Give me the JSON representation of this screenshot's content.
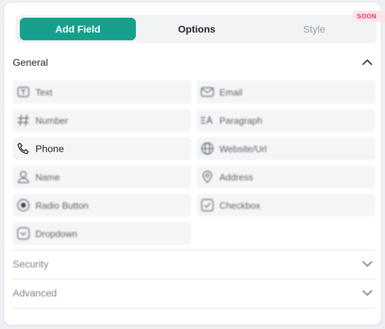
{
  "tabs": {
    "add_field": "Add Field",
    "options": "Options",
    "style": "Style",
    "soon_badge": "SOON"
  },
  "sections": {
    "general": "General",
    "security": "Security",
    "advanced": "Advanced"
  },
  "fields": [
    {
      "label": "Text",
      "icon": "text-box-icon"
    },
    {
      "label": "Email",
      "icon": "envelope-icon"
    },
    {
      "label": "Number",
      "icon": "hash-icon"
    },
    {
      "label": "Paragraph",
      "icon": "paragraph-icon"
    },
    {
      "label": "Phone",
      "icon": "phone-icon"
    },
    {
      "label": "Website/Url",
      "icon": "globe-icon"
    },
    {
      "label": "Name",
      "icon": "person-icon"
    },
    {
      "label": "Address",
      "icon": "map-pin-icon"
    },
    {
      "label": "Radio Button",
      "icon": "radio-icon"
    },
    {
      "label": "Checkbox",
      "icon": "checkbox-icon"
    },
    {
      "label": "Dropdown",
      "icon": "dropdown-icon"
    }
  ],
  "colors": {
    "accent": "#16a08c",
    "badge_bg": "#fde4ea",
    "badge_text": "#e0396a"
  }
}
